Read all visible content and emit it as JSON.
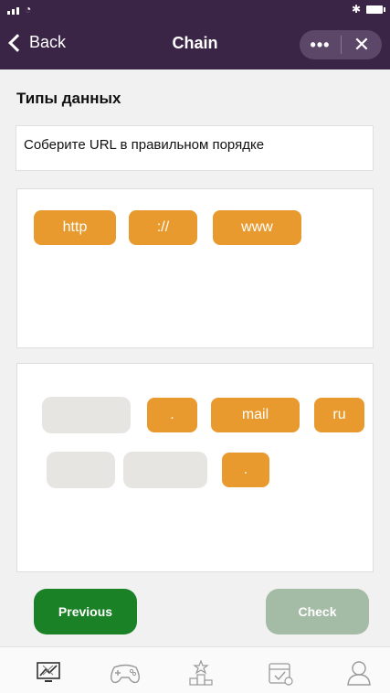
{
  "status_bar": {
    "wifi_icon": "wifi-icon",
    "bluetooth_icon": "bluetooth-icon",
    "battery_icon": "battery-icon"
  },
  "nav": {
    "back_label": "Back",
    "title": "Chain",
    "more_label": "•••",
    "close_label": "✕"
  },
  "section_title": "Типы данных",
  "prompt": "Соберите URL в правильном порядке",
  "answer_chips": [
    "http",
    "://",
    "www"
  ],
  "pool": {
    "chips": [
      ".",
      "mail",
      "ru",
      "."
    ],
    "empty_slots": 3
  },
  "buttons": {
    "previous": "Previous",
    "check": "Check"
  },
  "tabs": [
    "learn-icon",
    "games-icon",
    "ranking-icon",
    "calendar-icon",
    "profile-icon"
  ],
  "colors": {
    "header": "#3b2547",
    "chip": "#e89a2e",
    "previous_button": "#1a8127",
    "check_button": "#a4bba5",
    "slot": "#e6e5e2"
  }
}
